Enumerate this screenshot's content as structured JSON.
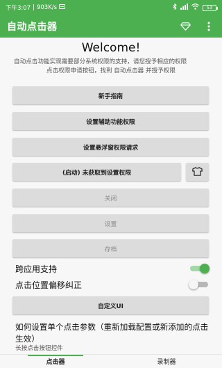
{
  "status_bar": {
    "time": "下午3:07",
    "separator": "|",
    "speed": "903K/s",
    "battery": "53"
  },
  "app_bar": {
    "title": "自动点击器",
    "accent_color": "#4caf50"
  },
  "main": {
    "welcome": "Welcome!",
    "intro_line1": "自动点击功能实现需要部分系统权限的支持，请您授予相应的权限",
    "intro_line2": "点击权限申请按钮，找到 自动点击器 并授予权限",
    "buttons": {
      "guide": "新手指南",
      "accessibility": "设置辅助功能权限",
      "overlay": "设置悬浮窗权限请求",
      "start_status": "(启动) 未获取到设置权限",
      "close": "关闭",
      "settings": "设置",
      "save": "存档",
      "custom_ui": "自定义UI"
    },
    "switches": {
      "cross_app": {
        "label": "跨应用支持",
        "on": true
      },
      "offset_fix": {
        "label": "点击位置偏移纠正",
        "on": false
      }
    },
    "help_title": "如何设置单个点击参数（重新加载配置或新添加的点击生效）",
    "help_sub": "长按点击按钮控件"
  },
  "bottom_nav": {
    "tabs": [
      "点击器",
      "录制器"
    ],
    "active": 0
  }
}
